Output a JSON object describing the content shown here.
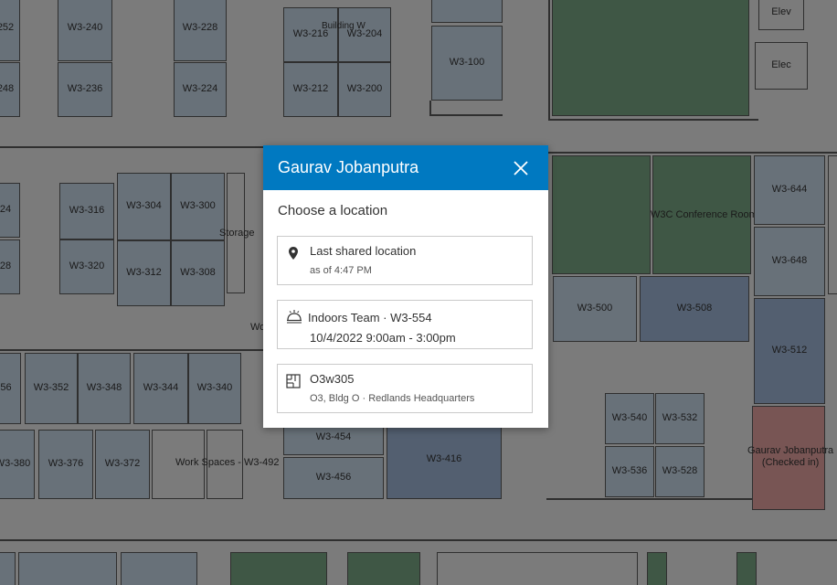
{
  "map": {
    "building_label": "Building W",
    "rooms": {
      "r252": "252",
      "r240": "W3-240",
      "r228": "W3-228",
      "r216": "W3-216",
      "r204": "W3-204",
      "r100": "W3-100",
      "elev": "Elev",
      "elec": "Elec",
      "r248": "248",
      "r236": "W3-236",
      "r224": "W3-224",
      "r212": "W3-212",
      "r200": "W3-200",
      "r24": "24",
      "r316": "W3-316",
      "r304": "W3-304",
      "r300": "W3-300",
      "storage": "Storage",
      "r28": "28",
      "r320": "W3-320",
      "r312": "W3-312",
      "r308": "W3-308",
      "conf": "W3C Conference Room",
      "r644": "W3-644",
      "r648": "W3-648",
      "r500": "W3-500",
      "r508": "W3-508",
      "r512": "W3-512",
      "wo": "Wo",
      "r56": "56",
      "r352": "W3-352",
      "r348": "W3-348",
      "r344": "W3-344",
      "r340": "W3-340",
      "r540": "W3-540",
      "r532": "W3-532",
      "r380": "W3-380",
      "r376": "W3-376",
      "r372": "W3-372",
      "workspaces": "Work Spaces - W3-492",
      "r454": "W3-454",
      "r416": "W3-416",
      "r456": "W3-456",
      "r536": "W3-536",
      "r528": "W3-528",
      "checkin": "Gaurav Jobanputra\n(Checked in)"
    }
  },
  "dialog": {
    "title": "Gaurav Jobanputra",
    "prompt": "Choose a location",
    "options": [
      {
        "icon": "location-pin-icon",
        "title": "Last shared location",
        "subtitle": "as of 4:47 PM"
      },
      {
        "icon": "desk-bell-icon",
        "title": "Indoors Team · W3-554",
        "subtitle": "10/4/2022 9:00am - 3:00pm"
      },
      {
        "icon": "floor-plan-icon",
        "title": "O3w305",
        "subtitle": "O3, Bldg O · Redlands Headquarters"
      }
    ]
  },
  "colors": {
    "header": "#0079c1",
    "room": "#c8d8e8",
    "room_green": "#7aa884",
    "room_blue": "#9fb6d6",
    "room_checked_in": "#e7a3a1"
  }
}
